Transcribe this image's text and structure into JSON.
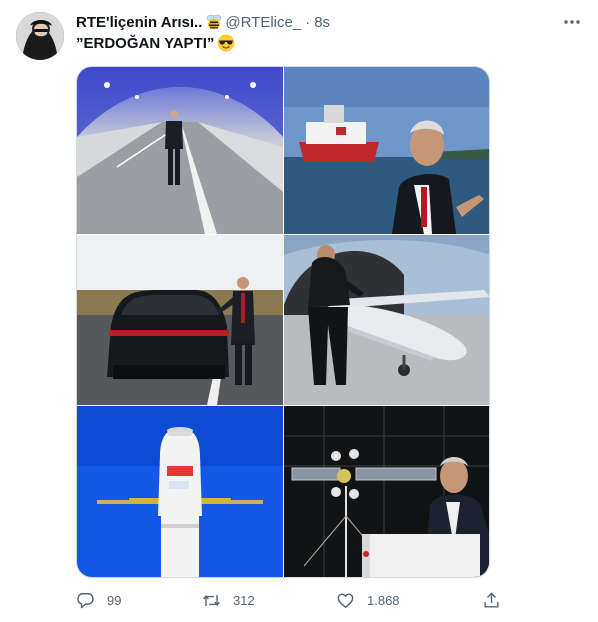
{
  "tweet": {
    "display_name": "RTE'liçenin Arısı..",
    "handle": "@RTElice_",
    "separator": "·",
    "time": "8s",
    "text": "”ERDOĞAN YAPTI”"
  },
  "media": {
    "photos": [
      {
        "subject": "tunnel"
      },
      {
        "subject": "drill-ship"
      },
      {
        "subject": "car"
      },
      {
        "subject": "drone"
      },
      {
        "subject": "satellite-rocket"
      },
      {
        "subject": "satellite-podium"
      }
    ]
  },
  "actions": {
    "replies": "99",
    "retweets": "312",
    "likes": "1.868"
  },
  "colors": {
    "text_primary": "#0f1419",
    "text_secondary": "#536471",
    "border": "#cfd9de"
  }
}
